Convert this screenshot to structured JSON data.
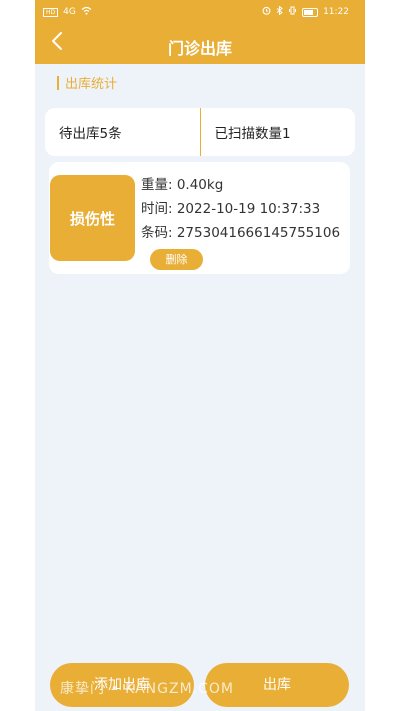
{
  "status_bar": {
    "left_indicators": [
      "HD",
      "4G"
    ],
    "time": "11:22",
    "battery_level": "97"
  },
  "header": {
    "title": "门诊出库",
    "background_color": "#e8ae35"
  },
  "section": {
    "title": "出库统计"
  },
  "stats": {
    "pending": "待出库5条",
    "scanned": "已扫描数量1"
  },
  "items": [
    {
      "category": "损伤性",
      "weight": "重量: 0.40kg",
      "time": "时间: 2022-10-19 10:37:33",
      "barcode": "条码: 2753041666145755106",
      "delete_label": "删除"
    }
  ],
  "actions": {
    "add_label": "添加出库",
    "out_label": "出库"
  },
  "watermark": "康挚门 • KANGZM.COM",
  "colors": {
    "accent": "#e8ae35",
    "page_bg": "#eef3fa"
  }
}
